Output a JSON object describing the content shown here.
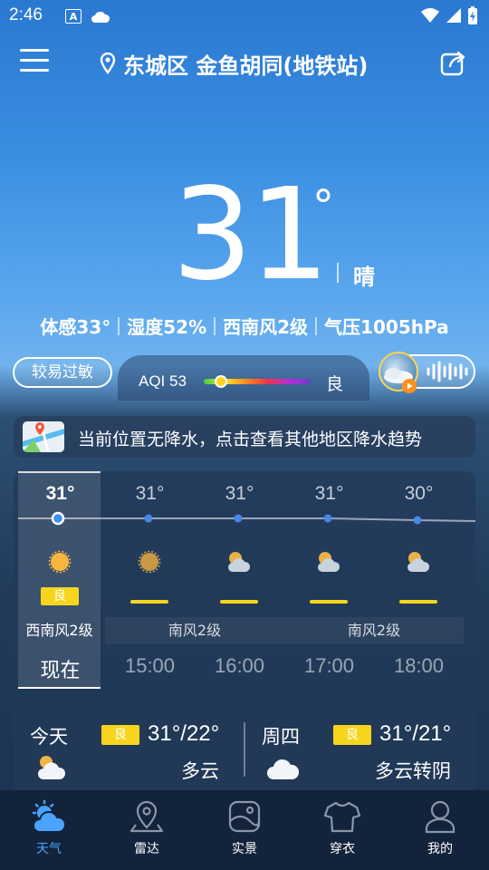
{
  "status_bar": {
    "time": "2:46"
  },
  "header": {
    "location": "东城区 金鱼胡同(地铁站)"
  },
  "current": {
    "temperature": "31",
    "degree": "°",
    "condition": "晴",
    "details": [
      "体感33°",
      "湿度52%",
      "西南风2级",
      "气压1005hPa"
    ],
    "allergy": "较易过敏"
  },
  "aqi": {
    "label": "AQI 53",
    "value": 53,
    "level": "良"
  },
  "rain_banner": {
    "text": "当前位置无降水，点击查看其他地区降水趋势"
  },
  "hourly": {
    "temps": [
      "31°",
      "31°",
      "31°",
      "31°",
      "30°"
    ],
    "badge": "良",
    "winds": [
      "西南风2级",
      "南风2级",
      "南风2级"
    ],
    "times": [
      "现在",
      "15:00",
      "16:00",
      "17:00",
      "18:00"
    ]
  },
  "daily": [
    {
      "day": "今天",
      "aqi": "良",
      "range": "31°/22°",
      "condition": "多云"
    },
    {
      "day": "周四",
      "aqi": "良",
      "range": "31°/21°",
      "condition": "多云转阴"
    }
  ],
  "nav": [
    {
      "label": "天气",
      "icon": "weather-icon",
      "active": true
    },
    {
      "label": "雷达",
      "icon": "radar-pin-icon",
      "active": false
    },
    {
      "label": "实景",
      "icon": "photo-icon",
      "active": false
    },
    {
      "label": "穿衣",
      "icon": "shirt-icon",
      "active": false
    },
    {
      "label": "我的",
      "icon": "profile-icon",
      "active": false
    }
  ],
  "colors": {
    "accent": "#4aa3ff",
    "aqi_badge": "#f7d51d",
    "nav_bg": "#13233b"
  }
}
